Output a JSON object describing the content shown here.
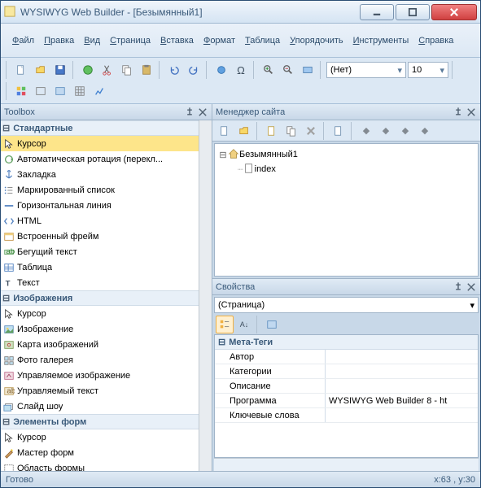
{
  "title": "WYSIWYG Web Builder - [Безымянный1]",
  "menu": [
    "Файл",
    "Правка",
    "Вид",
    "Страница",
    "Вставка",
    "Формат",
    "Таблица",
    "Упорядочить",
    "Инструменты",
    "Справка"
  ],
  "toolbar_combos": {
    "net": "(Нет)",
    "size": "10"
  },
  "toolbox": {
    "title": "Toolbox",
    "groups": [
      {
        "label": "Стандартные",
        "items": [
          {
            "label": "Курсор",
            "icon": "cursor",
            "selected": true
          },
          {
            "label": "Автоматическая ротация (перекл...",
            "icon": "rotate"
          },
          {
            "label": "Закладка",
            "icon": "anchor"
          },
          {
            "label": "Маркированный список",
            "icon": "list"
          },
          {
            "label": "Горизонтальная линия",
            "icon": "hr"
          },
          {
            "label": "HTML",
            "icon": "html"
          },
          {
            "label": "Встроенный фрейм",
            "icon": "iframe"
          },
          {
            "label": "Бегущий текст",
            "icon": "marquee"
          },
          {
            "label": "Таблица",
            "icon": "table"
          },
          {
            "label": "Текст",
            "icon": "text"
          }
        ]
      },
      {
        "label": "Изображения",
        "items": [
          {
            "label": "Курсор",
            "icon": "cursor"
          },
          {
            "label": "Изображение",
            "icon": "image"
          },
          {
            "label": "Карта изображений",
            "icon": "imagemap"
          },
          {
            "label": "Фото галерея",
            "icon": "gallery"
          },
          {
            "label": "Управляемое изображение",
            "icon": "ctrl-image"
          },
          {
            "label": "Управляемый текст",
            "icon": "ctrl-text"
          },
          {
            "label": "Слайд шоу",
            "icon": "slideshow"
          }
        ]
      },
      {
        "label": "Элементы форм",
        "items": [
          {
            "label": "Курсор",
            "icon": "cursor"
          },
          {
            "label": "Мастер форм",
            "icon": "wizard"
          },
          {
            "label": "Область формы",
            "icon": "formarea"
          }
        ]
      }
    ]
  },
  "sitemanager": {
    "title": "Менеджер сайта",
    "root": "Безымянный1",
    "child": "index"
  },
  "properties": {
    "title": "Свойства",
    "scope": "(Страница)",
    "group": "Мета-Теги",
    "rows": [
      {
        "name": "Автор",
        "value": ""
      },
      {
        "name": "Категории",
        "value": ""
      },
      {
        "name": "Описание",
        "value": ""
      },
      {
        "name": "Программа",
        "value": "WYSIWYG Web Builder 8 - ht"
      },
      {
        "name": "Ключевые слова",
        "value": ""
      }
    ]
  },
  "status": {
    "left": "Готово",
    "right": "x:63 , y:30"
  }
}
